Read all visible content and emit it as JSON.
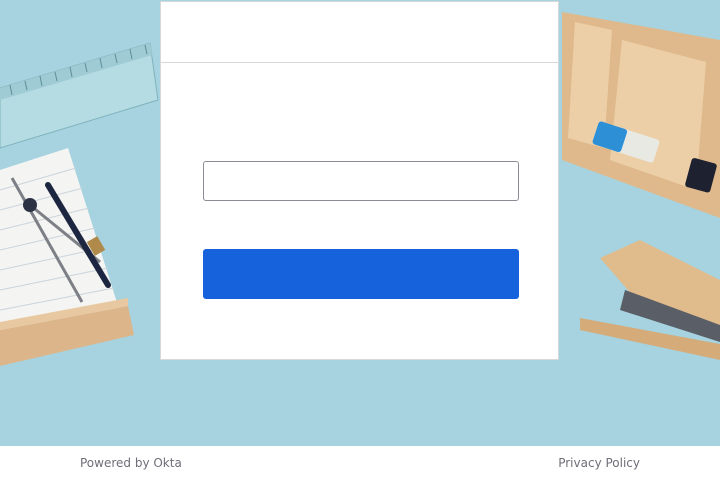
{
  "login": {
    "username_value": "",
    "username_placeholder": "",
    "submit_label": ""
  },
  "footer": {
    "powered_by": "Powered by Okta",
    "privacy_policy": "Privacy Policy"
  },
  "colors": {
    "background": "#a6d3df",
    "primary_button": "#1662dd",
    "footer_text": "#6e6e78"
  }
}
